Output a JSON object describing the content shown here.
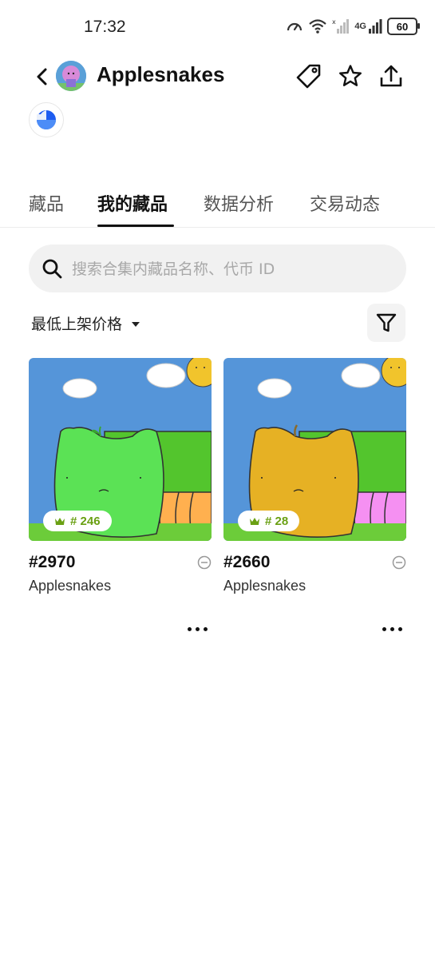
{
  "status_bar": {
    "time": "17:32",
    "battery": "60",
    "network": "4G"
  },
  "header": {
    "title": "Applesnakes"
  },
  "tabs": [
    {
      "label": "藏品",
      "active": false
    },
    {
      "label": "我的藏品",
      "active": true
    },
    {
      "label": "数据分析",
      "active": false
    },
    {
      "label": "交易动态",
      "active": false
    }
  ],
  "search": {
    "placeholder": "搜索合集内藏品名称、代币 ID"
  },
  "sort": {
    "label": "最低上架价格"
  },
  "items": [
    {
      "token": "#2970",
      "collection": "Applesnakes",
      "rank": "# 246",
      "apple_color": "#5be255",
      "stem_color": "#3aa52f",
      "tail_color": "#ffb04f"
    },
    {
      "token": "#2660",
      "collection": "Applesnakes",
      "rank": "# 28",
      "apple_color": "#e6b124",
      "stem_color": "#8a6a2a",
      "tail_color": "#f590f2"
    }
  ]
}
